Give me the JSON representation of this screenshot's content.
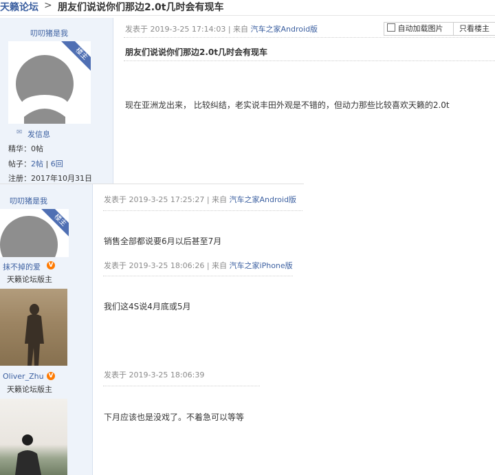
{
  "header": {
    "forum_name": "天籁论坛",
    "chevron": ">",
    "thread_title": "朋友们说说你们那边2.0t几时会有现车"
  },
  "toolbar": {
    "auto_load_images": "自动加载图片",
    "only_op": "只看楼主"
  },
  "posts": [
    {
      "username": "叨叨猪是我",
      "badge": "楼主",
      "send_msg": "发信息",
      "stats": {
        "jinghua_label": "精华：",
        "jinghua_value": "0帖",
        "tiezi_label": "帖子：",
        "tiezi_value": "2帖",
        "sep": "|",
        "huifu": "6回",
        "reg_label": "注册：",
        "reg_value": "2017年10月31日"
      },
      "meta_prefix": "发表于 2019-3-25 17:14:03 | 来自",
      "meta_source": "汽车之家Android版",
      "subject": "朋友们说说你们那边2.0t几时会有现车",
      "content": "现在亚洲龙出来， 比较纠结，老实说丰田外观是不错的，但动力那些比较喜欢天籁的2.0t"
    },
    {
      "username": "叨叨猪是我",
      "badge": "楼主",
      "meta_prefix": "发表于 2019-3-25 17:25:27 | 来自",
      "meta_source": "汽车之家Android版",
      "content": "销售全部都说要6月以后甚至7月"
    },
    {
      "username": "抹不掉的爱",
      "verified": "V",
      "role": "天籁论坛版主",
      "meta_prefix": "发表于 2019-3-25 18:06:26 | 来自",
      "meta_source": "汽车之家iPhone版",
      "content": "我们这4S说4月底或5月"
    },
    {
      "username": "Oliver_Zhu",
      "verified": "V",
      "role": "天籁论坛版主",
      "meta_prefix": "发表于 2019-3-25 18:06:39",
      "content": "下月应该也是没戏了。不着急可以等等"
    }
  ],
  "colors": {
    "link": "#3b5fa0",
    "sidebar_bg": "#eef3fa",
    "ribbon": "#4f6fb3",
    "verified": "#ff7a00"
  }
}
